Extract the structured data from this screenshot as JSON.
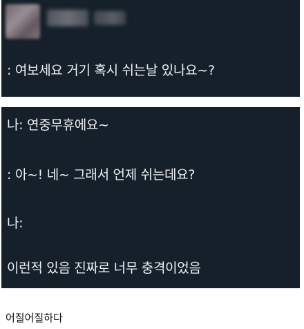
{
  "post": {
    "avatar": {
      "icon": "profile-photo-blurred"
    },
    "author_name": "",
    "author_handle": "",
    "first_line": ": 여보세요 거기 혹시 쉬는날 있나요~?"
  },
  "reply": {
    "lines": [
      "나: 연중무휴에요~",
      ": 아~! 네~ 그래서 언제 쉬는데요?",
      "나:",
      "이런적 있음 진짜로 너무 충격이었음"
    ]
  },
  "caption": "어질어질하다",
  "colors": {
    "panel_bg": "#15202b",
    "panel_text": "#eef1f4",
    "page_bg": "#ffffff",
    "caption_text": "#111111"
  }
}
